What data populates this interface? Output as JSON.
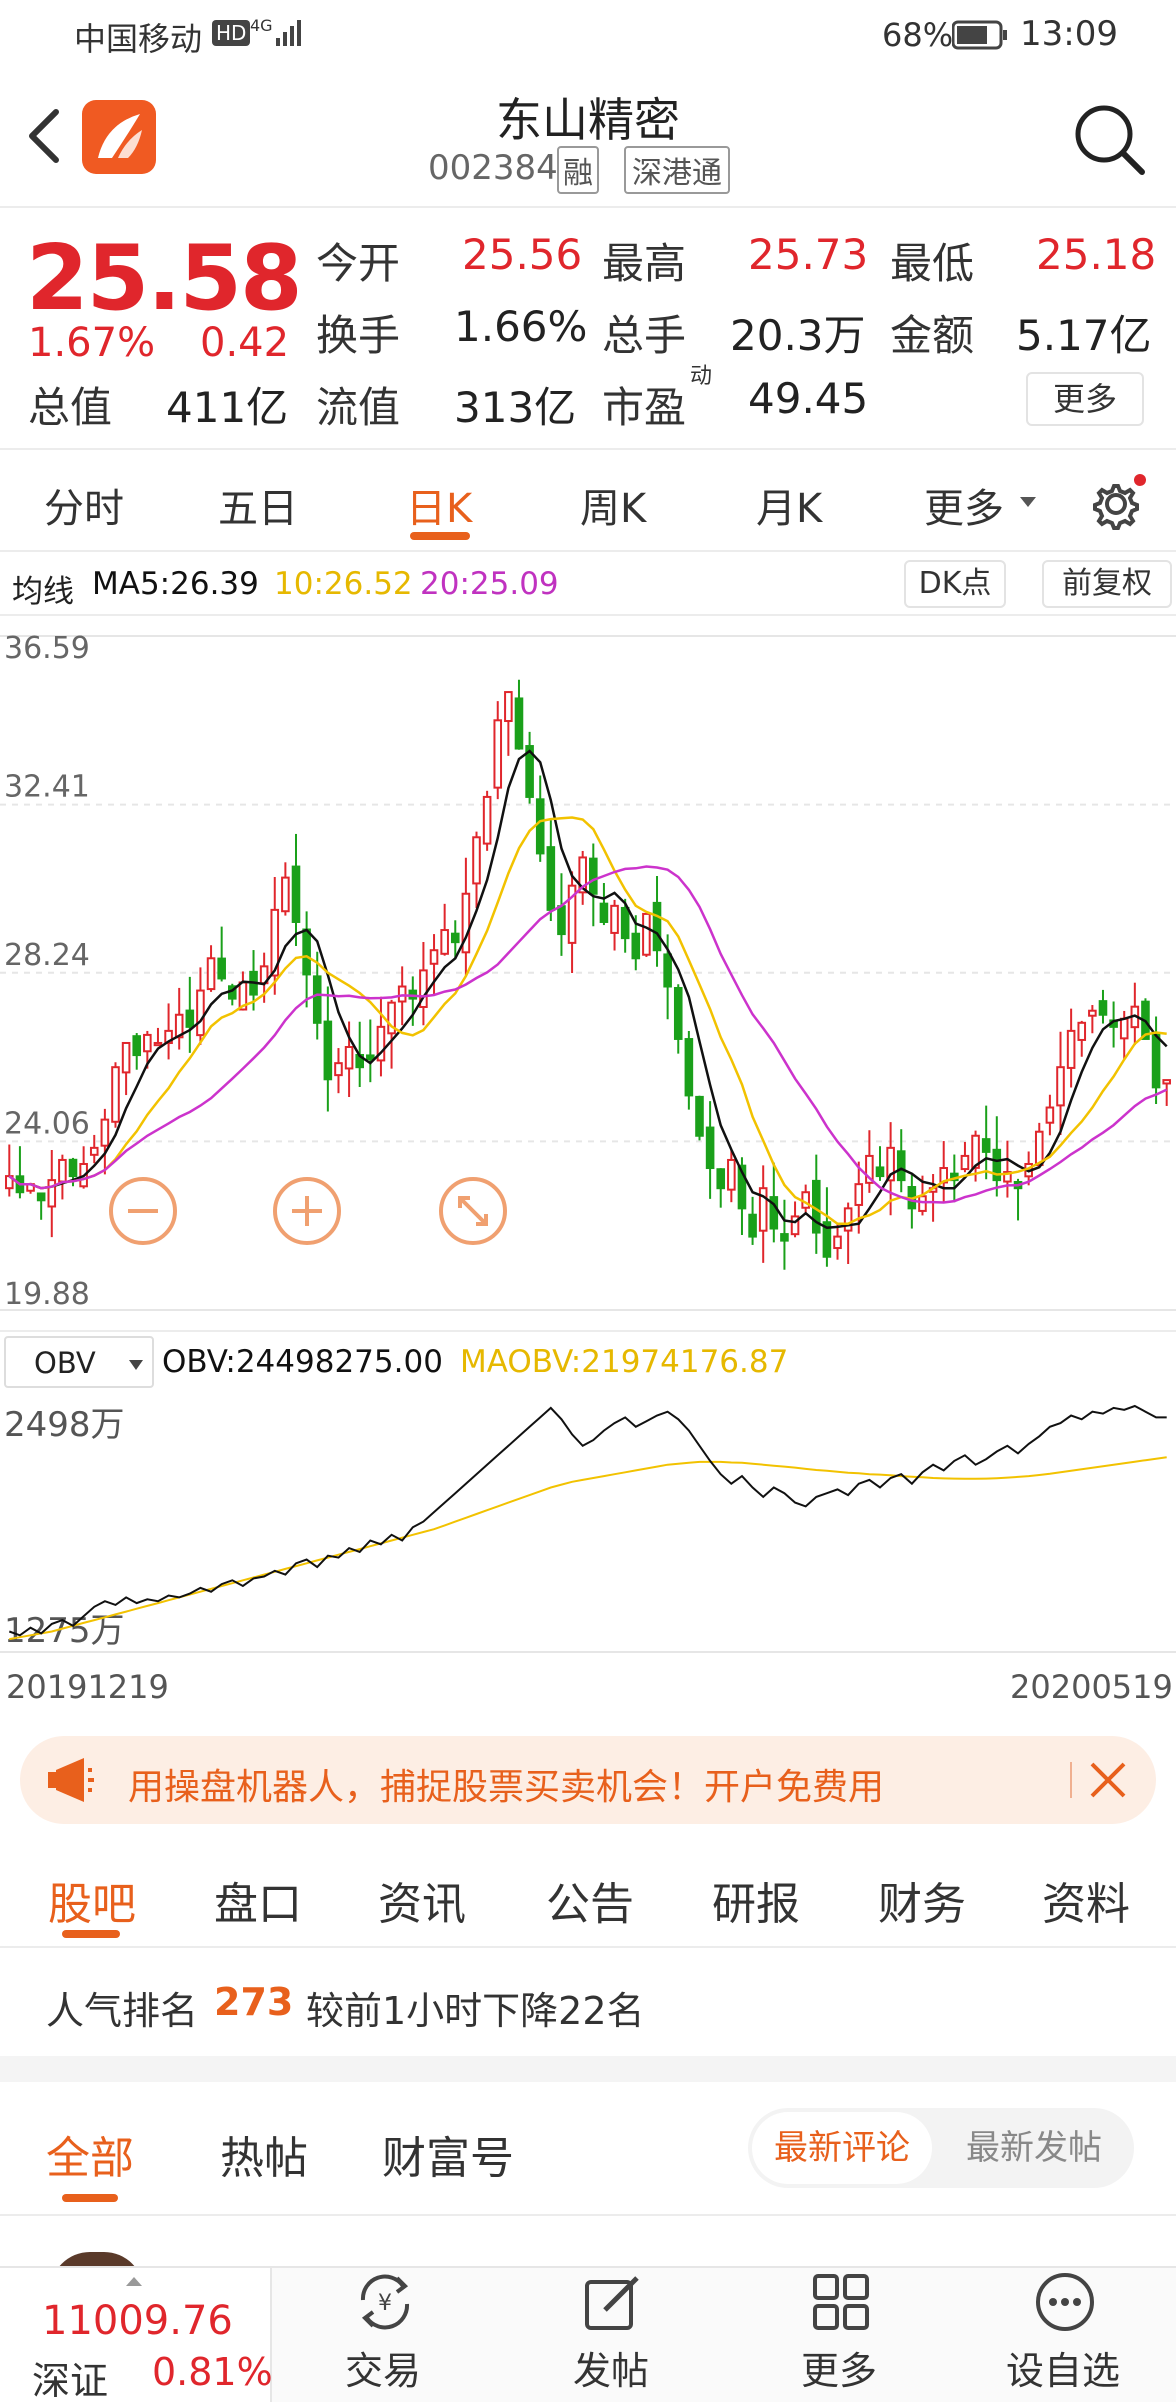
{
  "status_bar": {
    "carrier": "中国移动",
    "hd": "HD",
    "net": "4G",
    "battery": "68%",
    "time": "13:09"
  },
  "header": {
    "title": "东山精密",
    "code": "002384",
    "tags": [
      "融",
      "深港通"
    ]
  },
  "quote": {
    "price": "25.58",
    "change_pct": "1.67%",
    "change": "0.42",
    "stats": [
      {
        "label": "今开",
        "value": "25.56",
        "red": true
      },
      {
        "label": "最高",
        "value": "25.73",
        "red": true
      },
      {
        "label": "最低",
        "value": "25.18",
        "red": true
      },
      {
        "label": "换手",
        "value": "1.66%",
        "red": false
      },
      {
        "label": "总手",
        "value": "20.3万",
        "red": false
      },
      {
        "label": "金额",
        "value": "5.17亿",
        "red": false
      },
      {
        "label": "总值",
        "value": "411亿",
        "red": false
      },
      {
        "label": "流值",
        "value": "313亿",
        "red": false
      },
      {
        "label": "市盈",
        "sup": "动",
        "value": "49.45",
        "red": false
      }
    ],
    "more_label": "更多"
  },
  "period_tabs": {
    "items": [
      "分时",
      "五日",
      "日K",
      "周K",
      "月K",
      "更多"
    ],
    "active": 2
  },
  "indicators": {
    "ma_label": "均线",
    "ma5": "MA5:26.39",
    "ma10": "10:26.52",
    "ma20": "20:25.09",
    "dk_button": "DK点",
    "fq_button": "前复权"
  },
  "chart_data": [
    {
      "type": "candlestick",
      "title": "日K",
      "ylim": [
        19.88,
        36.59
      ],
      "y_ticks": [
        "36.59",
        "32.41",
        "28.24",
        "24.06",
        "19.88"
      ],
      "x_range": [
        "20191219",
        "20200519"
      ],
      "series": [
        {
          "name": "MA5",
          "last": 26.39,
          "color": "#111111"
        },
        {
          "name": "MA10",
          "last": 26.52,
          "color": "#f2c200"
        },
        {
          "name": "MA20",
          "last": 25.09,
          "color": "#cc33cc"
        }
      ],
      "closes": [
        23.2,
        22.8,
        23.0,
        22.6,
        23.1,
        23.6,
        23.2,
        23.5,
        23.9,
        24.6,
        25.9,
        26.5,
        26.2,
        26.7,
        26.5,
        26.8,
        27.2,
        26.9,
        27.8,
        28.6,
        28.1,
        27.6,
        28.0,
        27.7,
        28.4,
        29.8,
        30.6,
        29.5,
        28.2,
        27.0,
        25.6,
        26.0,
        26.4,
        25.9,
        26.1,
        26.9,
        27.5,
        27.9,
        27.6,
        28.3,
        28.8,
        29.3,
        29.0,
        30.2,
        31.6,
        32.6,
        34.5,
        35.2,
        33.8,
        32.6,
        31.2,
        29.8,
        29.2,
        30.4,
        31.1,
        30.2,
        29.5,
        29.9,
        29.1,
        28.6,
        29.7,
        28.8,
        27.9,
        26.6,
        25.2,
        24.2,
        23.4,
        22.9,
        23.6,
        22.4,
        21.7,
        22.9,
        21.9,
        21.6,
        22.2,
        22.8,
        21.8,
        21.2,
        21.7,
        22.4,
        23.0,
        23.7,
        23.2,
        23.9,
        23.1,
        22.4,
        22.7,
        22.9,
        23.4,
        23.1,
        23.7,
        24.2,
        23.8,
        23.1,
        23.3,
        22.9,
        23.5,
        24.3,
        24.9,
        25.9,
        26.8,
        27.0,
        27.3,
        27.2,
        26.9,
        27.1,
        27.4,
        26.6,
        25.4,
        25.58
      ],
      "volume_note": "",
      "controls": [
        "zoom-out",
        "zoom-in",
        "fullscreen"
      ]
    },
    {
      "type": "line",
      "title": "OBV",
      "y_ticks": [
        "2498万",
        "1275万"
      ],
      "series": [
        {
          "name": "OBV",
          "value": "24498275.00",
          "color": "#111111"
        },
        {
          "name": "MAOBV",
          "value": "21974176.87",
          "color": "#f2c200"
        }
      ],
      "obv": [
        1320,
        1300,
        1340,
        1310,
        1360,
        1380,
        1350,
        1400,
        1450,
        1480,
        1460,
        1500,
        1470,
        1490,
        1480,
        1510,
        1500,
        1520,
        1550,
        1530,
        1570,
        1590,
        1560,
        1600,
        1610,
        1640,
        1620,
        1680,
        1700,
        1660,
        1720,
        1710,
        1760,
        1740,
        1800,
        1780,
        1830,
        1800,
        1870,
        1900,
        1950,
        2000,
        2050,
        2100,
        2150,
        2200,
        2250,
        2300,
        2350,
        2400,
        2450,
        2500,
        2440,
        2360,
        2300,
        2330,
        2380,
        2420,
        2450,
        2400,
        2430,
        2460,
        2480,
        2440,
        2380,
        2300,
        2220,
        2150,
        2100,
        2140,
        2080,
        2030,
        2080,
        2050,
        2000,
        1980,
        2030,
        2050,
        2070,
        2040,
        2100,
        2120,
        2080,
        2130,
        2150,
        2100,
        2160,
        2200,
        2170,
        2220,
        2250,
        2200,
        2230,
        2270,
        2300,
        2260,
        2310,
        2350,
        2400,
        2420,
        2460,
        2440,
        2480,
        2470,
        2500,
        2490,
        2510,
        2480,
        2450,
        2450
      ],
      "maobv": [
        1280,
        1290,
        1300,
        1310,
        1320,
        1335,
        1350,
        1365,
        1380,
        1395,
        1410,
        1425,
        1440,
        1455,
        1470,
        1485,
        1500,
        1515,
        1530,
        1545,
        1560,
        1575,
        1590,
        1605,
        1620,
        1635,
        1650,
        1665,
        1680,
        1695,
        1710,
        1725,
        1740,
        1755,
        1770,
        1785,
        1800,
        1815,
        1830,
        1845,
        1860,
        1880,
        1900,
        1920,
        1940,
        1960,
        1980,
        2000,
        2020,
        2040,
        2060,
        2080,
        2095,
        2110,
        2120,
        2130,
        2140,
        2150,
        2160,
        2170,
        2180,
        2190,
        2200,
        2205,
        2210,
        2215,
        2215,
        2215,
        2212,
        2210,
        2205,
        2200,
        2195,
        2190,
        2185,
        2178,
        2172,
        2168,
        2163,
        2158,
        2155,
        2150,
        2148,
        2144,
        2140,
        2137,
        2134,
        2130,
        2128,
        2127,
        2126,
        2126,
        2127,
        2129,
        2132,
        2136,
        2140,
        2146,
        2152,
        2160,
        2168,
        2176,
        2184,
        2192,
        2200,
        2208,
        2216,
        2224,
        2232,
        2240
      ]
    }
  ],
  "obv_header": {
    "select": "OBV",
    "obv_text": "OBV:24498275.00",
    "maobv_text": "MAOBV:21974176.87"
  },
  "ad_banner": {
    "text": "用操盘机器人，捕捉股票买卖机会！开户免费用"
  },
  "section_tabs": {
    "items": [
      "股吧",
      "盘口",
      "资讯",
      "公告",
      "研报",
      "财务",
      "资料"
    ],
    "active": 0
  },
  "popularity": {
    "prefix": "人气排名",
    "rank": "273",
    "suffix": "较前1小时下降22名"
  },
  "post_tabs": {
    "items": [
      "全部",
      "热帖",
      "财富号"
    ],
    "active": 0,
    "sort_options": [
      "最新评论",
      "最新发帖"
    ],
    "sort_active": 0
  },
  "bottom_bar": {
    "index_value": "11009.76",
    "index_name": "深证",
    "index_change": "0.81%",
    "items": [
      {
        "label": "交易",
        "icon": "yen-exchange-icon"
      },
      {
        "label": "发帖",
        "icon": "edit-icon"
      },
      {
        "label": "更多",
        "icon": "grid-icon"
      },
      {
        "label": "设自选",
        "icon": "dots-icon"
      }
    ]
  },
  "colors": {
    "up": "#e0262c",
    "down": "#1aa01a",
    "accent": "#e8601c"
  }
}
